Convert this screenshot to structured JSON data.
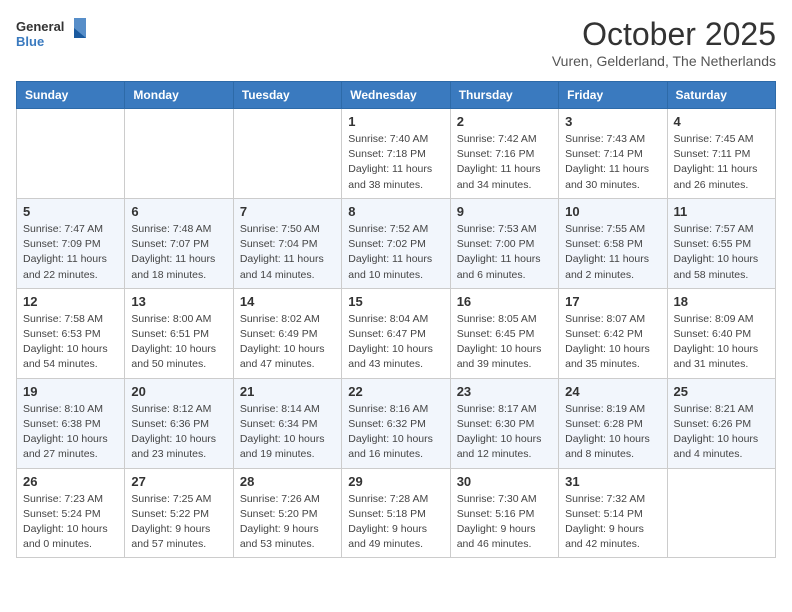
{
  "header": {
    "logo_line1": "General",
    "logo_line2": "Blue",
    "month": "October 2025",
    "location": "Vuren, Gelderland, The Netherlands"
  },
  "weekdays": [
    "Sunday",
    "Monday",
    "Tuesday",
    "Wednesday",
    "Thursday",
    "Friday",
    "Saturday"
  ],
  "weeks": [
    [
      {
        "day": "",
        "info": ""
      },
      {
        "day": "",
        "info": ""
      },
      {
        "day": "",
        "info": ""
      },
      {
        "day": "1",
        "info": "Sunrise: 7:40 AM\nSunset: 7:18 PM\nDaylight: 11 hours\nand 38 minutes."
      },
      {
        "day": "2",
        "info": "Sunrise: 7:42 AM\nSunset: 7:16 PM\nDaylight: 11 hours\nand 34 minutes."
      },
      {
        "day": "3",
        "info": "Sunrise: 7:43 AM\nSunset: 7:14 PM\nDaylight: 11 hours\nand 30 minutes."
      },
      {
        "day": "4",
        "info": "Sunrise: 7:45 AM\nSunset: 7:11 PM\nDaylight: 11 hours\nand 26 minutes."
      }
    ],
    [
      {
        "day": "5",
        "info": "Sunrise: 7:47 AM\nSunset: 7:09 PM\nDaylight: 11 hours\nand 22 minutes."
      },
      {
        "day": "6",
        "info": "Sunrise: 7:48 AM\nSunset: 7:07 PM\nDaylight: 11 hours\nand 18 minutes."
      },
      {
        "day": "7",
        "info": "Sunrise: 7:50 AM\nSunset: 7:04 PM\nDaylight: 11 hours\nand 14 minutes."
      },
      {
        "day": "8",
        "info": "Sunrise: 7:52 AM\nSunset: 7:02 PM\nDaylight: 11 hours\nand 10 minutes."
      },
      {
        "day": "9",
        "info": "Sunrise: 7:53 AM\nSunset: 7:00 PM\nDaylight: 11 hours\nand 6 minutes."
      },
      {
        "day": "10",
        "info": "Sunrise: 7:55 AM\nSunset: 6:58 PM\nDaylight: 11 hours\nand 2 minutes."
      },
      {
        "day": "11",
        "info": "Sunrise: 7:57 AM\nSunset: 6:55 PM\nDaylight: 10 hours\nand 58 minutes."
      }
    ],
    [
      {
        "day": "12",
        "info": "Sunrise: 7:58 AM\nSunset: 6:53 PM\nDaylight: 10 hours\nand 54 minutes."
      },
      {
        "day": "13",
        "info": "Sunrise: 8:00 AM\nSunset: 6:51 PM\nDaylight: 10 hours\nand 50 minutes."
      },
      {
        "day": "14",
        "info": "Sunrise: 8:02 AM\nSunset: 6:49 PM\nDaylight: 10 hours\nand 47 minutes."
      },
      {
        "day": "15",
        "info": "Sunrise: 8:04 AM\nSunset: 6:47 PM\nDaylight: 10 hours\nand 43 minutes."
      },
      {
        "day": "16",
        "info": "Sunrise: 8:05 AM\nSunset: 6:45 PM\nDaylight: 10 hours\nand 39 minutes."
      },
      {
        "day": "17",
        "info": "Sunrise: 8:07 AM\nSunset: 6:42 PM\nDaylight: 10 hours\nand 35 minutes."
      },
      {
        "day": "18",
        "info": "Sunrise: 8:09 AM\nSunset: 6:40 PM\nDaylight: 10 hours\nand 31 minutes."
      }
    ],
    [
      {
        "day": "19",
        "info": "Sunrise: 8:10 AM\nSunset: 6:38 PM\nDaylight: 10 hours\nand 27 minutes."
      },
      {
        "day": "20",
        "info": "Sunrise: 8:12 AM\nSunset: 6:36 PM\nDaylight: 10 hours\nand 23 minutes."
      },
      {
        "day": "21",
        "info": "Sunrise: 8:14 AM\nSunset: 6:34 PM\nDaylight: 10 hours\nand 19 minutes."
      },
      {
        "day": "22",
        "info": "Sunrise: 8:16 AM\nSunset: 6:32 PM\nDaylight: 10 hours\nand 16 minutes."
      },
      {
        "day": "23",
        "info": "Sunrise: 8:17 AM\nSunset: 6:30 PM\nDaylight: 10 hours\nand 12 minutes."
      },
      {
        "day": "24",
        "info": "Sunrise: 8:19 AM\nSunset: 6:28 PM\nDaylight: 10 hours\nand 8 minutes."
      },
      {
        "day": "25",
        "info": "Sunrise: 8:21 AM\nSunset: 6:26 PM\nDaylight: 10 hours\nand 4 minutes."
      }
    ],
    [
      {
        "day": "26",
        "info": "Sunrise: 7:23 AM\nSunset: 5:24 PM\nDaylight: 10 hours\nand 0 minutes."
      },
      {
        "day": "27",
        "info": "Sunrise: 7:25 AM\nSunset: 5:22 PM\nDaylight: 9 hours\nand 57 minutes."
      },
      {
        "day": "28",
        "info": "Sunrise: 7:26 AM\nSunset: 5:20 PM\nDaylight: 9 hours\nand 53 minutes."
      },
      {
        "day": "29",
        "info": "Sunrise: 7:28 AM\nSunset: 5:18 PM\nDaylight: 9 hours\nand 49 minutes."
      },
      {
        "day": "30",
        "info": "Sunrise: 7:30 AM\nSunset: 5:16 PM\nDaylight: 9 hours\nand 46 minutes."
      },
      {
        "day": "31",
        "info": "Sunrise: 7:32 AM\nSunset: 5:14 PM\nDaylight: 9 hours\nand 42 minutes."
      },
      {
        "day": "",
        "info": ""
      }
    ]
  ]
}
